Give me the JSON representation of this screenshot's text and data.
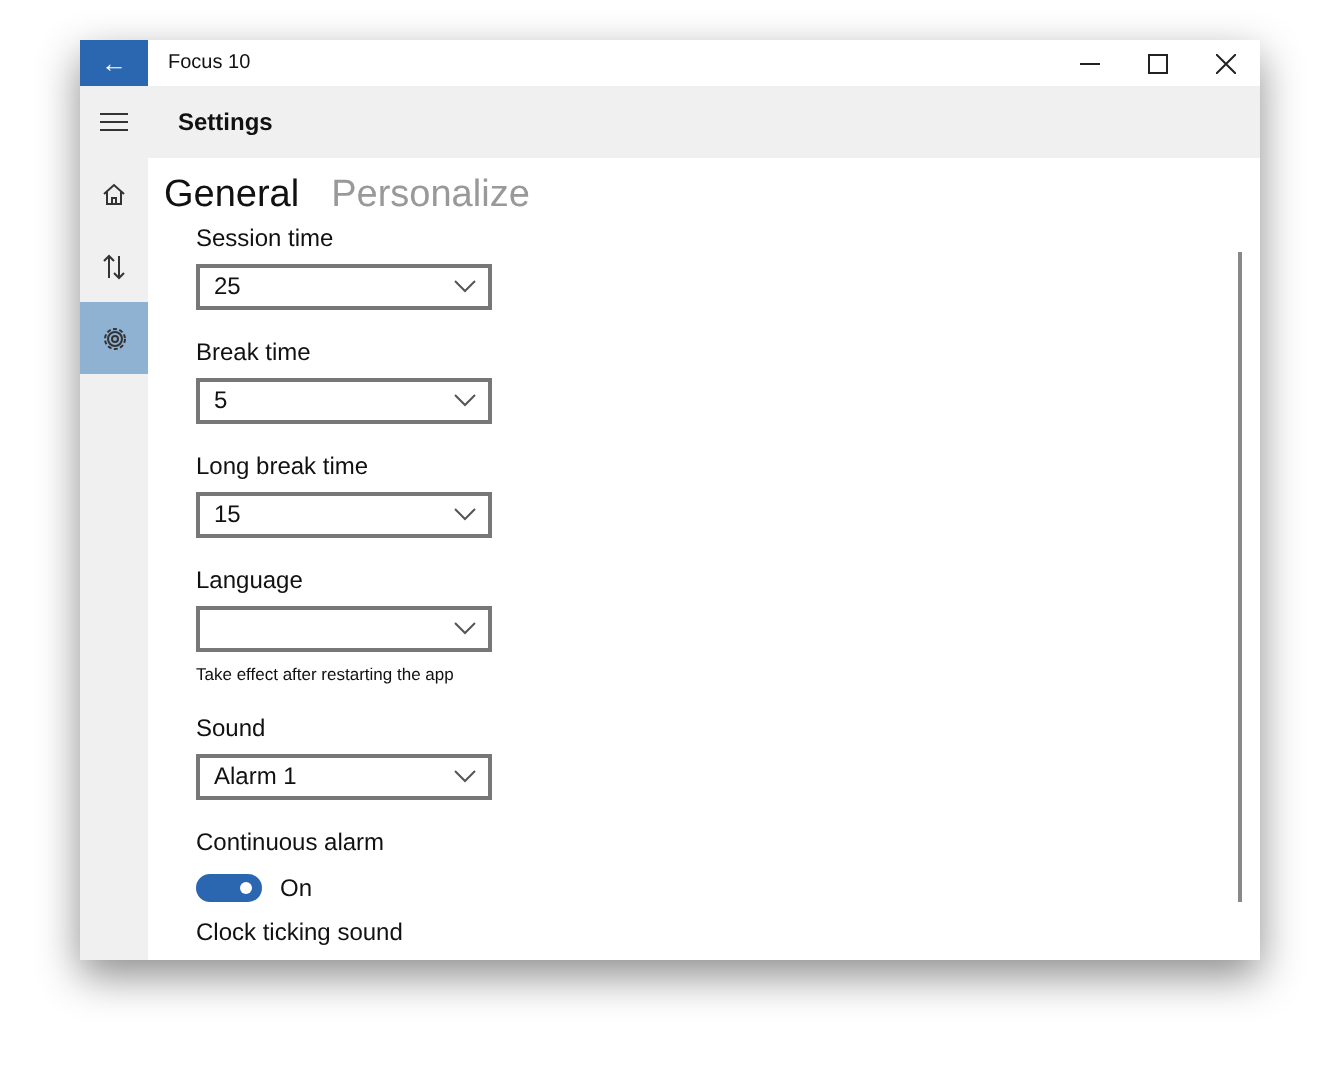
{
  "window": {
    "title": "Focus 10",
    "back": "←"
  },
  "header": {
    "title": "Settings"
  },
  "nav": [
    {
      "kind": "home",
      "selected": false
    },
    {
      "kind": "sort",
      "selected": false
    },
    {
      "kind": "settings",
      "selected": true
    }
  ],
  "tabs": [
    {
      "label": "General",
      "selected": true
    },
    {
      "label": "Personalize",
      "selected": false
    }
  ],
  "settings": [
    {
      "kind": "dropdown",
      "label": "Session time",
      "value": "25"
    },
    {
      "kind": "dropdown",
      "label": "Break time",
      "value": "5"
    },
    {
      "kind": "dropdown",
      "label": "Long break time",
      "value": "15"
    },
    {
      "kind": "dropdown",
      "label": "Language",
      "note": "Take effect after restarting the app"
    },
    {
      "kind": "dropdown",
      "label": "Sound",
      "value": "Alarm 1"
    },
    {
      "kind": "toggle",
      "label": "Continuous alarm",
      "on": true,
      "state": "On"
    },
    {
      "kind": "heading",
      "label": "Clock ticking sound"
    }
  ]
}
